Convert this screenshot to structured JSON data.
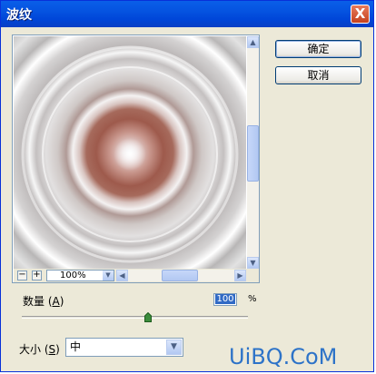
{
  "window": {
    "title": "波纹",
    "close_label": "X"
  },
  "preview": {
    "zoom_out_label": "−",
    "zoom_in_label": "+",
    "zoom_value": "100%"
  },
  "buttons": {
    "ok_label": "确定",
    "cancel_label": "取消"
  },
  "amount": {
    "label": "数量 (",
    "shortcut": "A",
    "label_end": ")",
    "value": "100",
    "unit": "%",
    "slider_level": 0.56
  },
  "size": {
    "label": "大小 (",
    "shortcut": "S",
    "label_end": ")",
    "selected": "中"
  },
  "watermark": "UiBQ.CoM"
}
